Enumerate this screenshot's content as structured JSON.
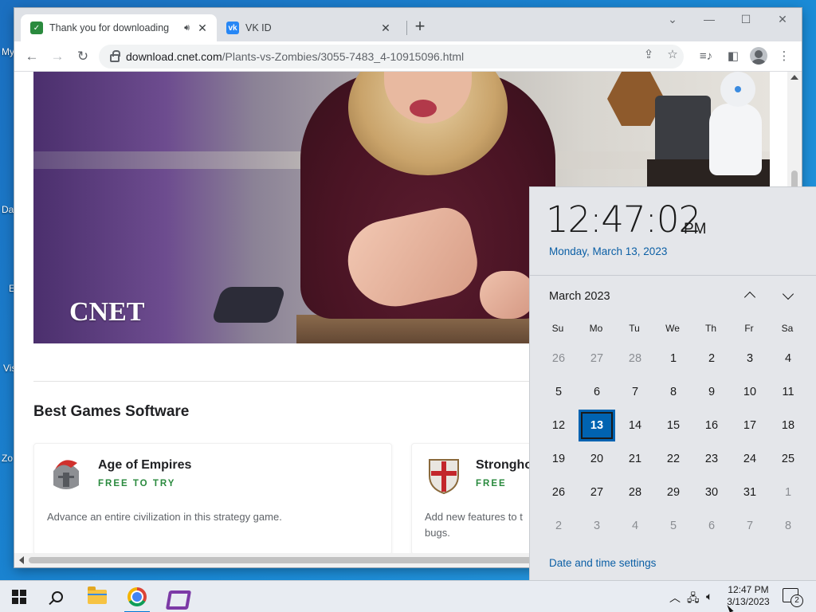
{
  "desktop": {
    "icon_labels": [
      "My",
      "Da",
      "E",
      "Vis",
      "Zo"
    ]
  },
  "browser": {
    "tabs": [
      {
        "title": "Thank you for downloading",
        "favicon": "cnet-favicon",
        "audio": true,
        "active": true
      },
      {
        "title": "VK ID",
        "favicon": "vk-favicon",
        "active": false
      }
    ],
    "new_tab": "+",
    "address_bar": {
      "domain": "download.cnet.com",
      "path": "/Plants-vs-Zombies/3055-7483_4-10915096.html"
    },
    "toolbar_icons": [
      "back-icon",
      "forward-icon",
      "reload-icon",
      "share-icon",
      "bookmark-star-icon",
      "media-icon",
      "side-panel-icon",
      "profile-icon",
      "menu-icon"
    ]
  },
  "page": {
    "video_logo": "CNET",
    "section_title": "Best Games Software",
    "cards": [
      {
        "name": "Age of Empires",
        "tag": "FREE TO TRY",
        "desc": "Advance an entire civilization in this strategy game."
      },
      {
        "name": "Strongho",
        "tag": "FREE",
        "desc": "Add new features to t bugs."
      }
    ]
  },
  "clock": {
    "time": "12:47:02",
    "ampm": "PM",
    "full_date": "Monday, March 13, 2023",
    "month_label": "March 2023",
    "weekdays": [
      "Su",
      "Mo",
      "Tu",
      "We",
      "Th",
      "Fr",
      "Sa"
    ],
    "days": [
      [
        {
          "d": "26",
          "dim": true
        },
        {
          "d": "27",
          "dim": true
        },
        {
          "d": "28",
          "dim": true
        },
        {
          "d": "1"
        },
        {
          "d": "2"
        },
        {
          "d": "3"
        },
        {
          "d": "4"
        }
      ],
      [
        {
          "d": "5"
        },
        {
          "d": "6"
        },
        {
          "d": "7"
        },
        {
          "d": "8"
        },
        {
          "d": "9"
        },
        {
          "d": "10"
        },
        {
          "d": "11"
        }
      ],
      [
        {
          "d": "12"
        },
        {
          "d": "13",
          "today": true
        },
        {
          "d": "14"
        },
        {
          "d": "15"
        },
        {
          "d": "16"
        },
        {
          "d": "17"
        },
        {
          "d": "18"
        }
      ],
      [
        {
          "d": "19"
        },
        {
          "d": "20"
        },
        {
          "d": "21"
        },
        {
          "d": "22"
        },
        {
          "d": "23"
        },
        {
          "d": "24"
        },
        {
          "d": "25"
        }
      ],
      [
        {
          "d": "26"
        },
        {
          "d": "27"
        },
        {
          "d": "28"
        },
        {
          "d": "29"
        },
        {
          "d": "30"
        },
        {
          "d": "31"
        },
        {
          "d": "1",
          "dim": true
        }
      ],
      [
        {
          "d": "2",
          "dim": true
        },
        {
          "d": "3",
          "dim": true
        },
        {
          "d": "4",
          "dim": true
        },
        {
          "d": "5",
          "dim": true
        },
        {
          "d": "6",
          "dim": true
        },
        {
          "d": "7",
          "dim": true
        },
        {
          "d": "8",
          "dim": true
        }
      ]
    ],
    "settings_link": "Date and time settings"
  },
  "taskbar": {
    "time": "12:47 PM",
    "date": "3/13/2023",
    "notification_count": "2",
    "apps": [
      "start-icon",
      "search-icon",
      "file-explorer-icon",
      "chrome-icon",
      "visual-studio-icon"
    ]
  },
  "colors": {
    "accent": "#0063b1",
    "link": "#0b5fa5",
    "free_tag": "#2a8a3e"
  }
}
